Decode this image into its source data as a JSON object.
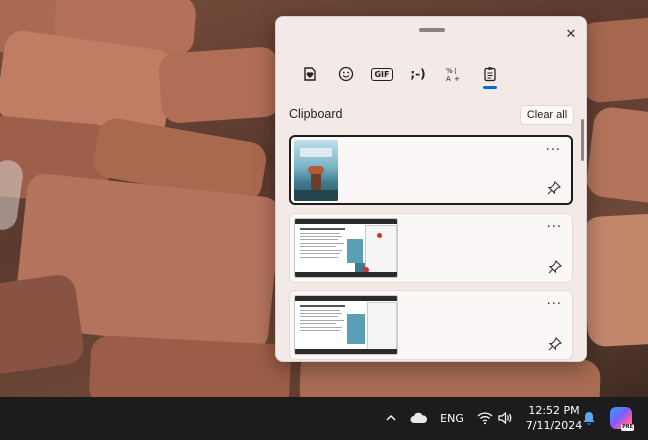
{
  "panel": {
    "close_label": "✕",
    "tabs": [
      {
        "name": "tab-favorites",
        "icon": "heart-sticker-icon"
      },
      {
        "name": "tab-emoji",
        "icon": "smiley-icon"
      },
      {
        "name": "tab-gif",
        "label": "GIF"
      },
      {
        "name": "tab-kaomoji",
        "label": ";-)"
      },
      {
        "name": "tab-symbols",
        "icon": "symbols-icon"
      },
      {
        "name": "tab-clipboard",
        "icon": "clipboard-icon",
        "active": true
      }
    ],
    "section_title": "Clipboard",
    "clear_all_label": "Clear all",
    "more_label": "···",
    "items": [
      {
        "type": "image",
        "selected": true
      },
      {
        "type": "image",
        "selected": false
      },
      {
        "type": "image",
        "selected": false
      }
    ]
  },
  "taskbar": {
    "language": "ENG",
    "time": "12:52 PM",
    "date": "7/11/2024",
    "copilot_badge": "PRE"
  },
  "colors": {
    "accent": "#0b6bcb",
    "taskbar": "#1c1c1c",
    "panel_bg": "#f3e9e6"
  }
}
